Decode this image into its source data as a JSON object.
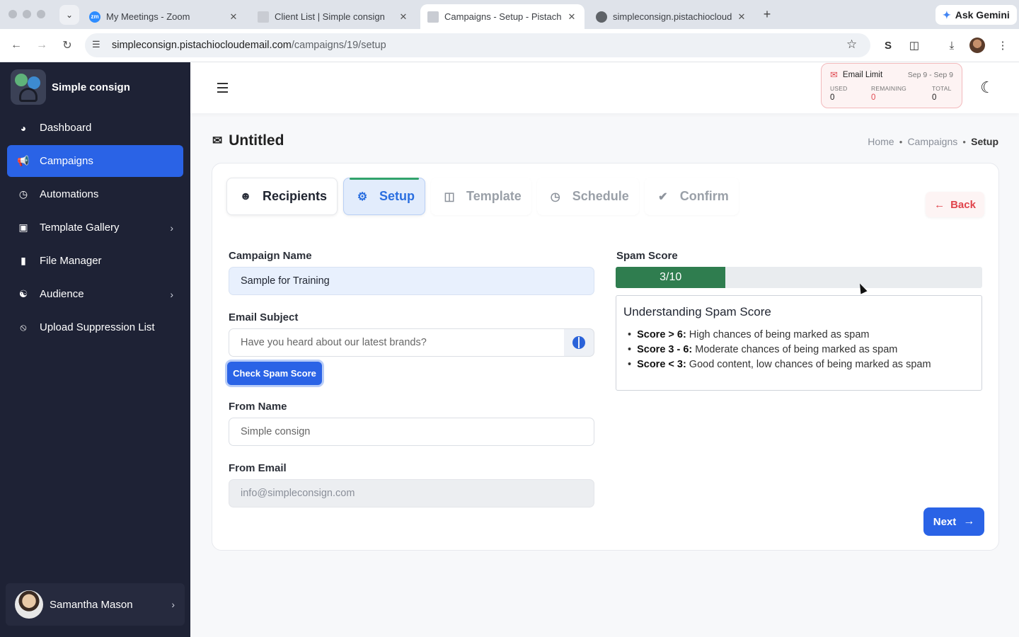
{
  "browser": {
    "tabs": [
      {
        "title": "My Meetings - Zoom",
        "favicon": "zoom-icon",
        "favicon_text": "zm",
        "favicon_color": "#2d8cff",
        "active": false
      },
      {
        "title": "Client List | Simple consign",
        "favicon": "pistachio-icon",
        "active": false
      },
      {
        "title": "Campaigns - Setup - Pistachi",
        "favicon": "pistachio-icon",
        "active": true
      },
      {
        "title": "simpleconsign.pistachiocloud",
        "favicon": "globe-icon",
        "active": false
      }
    ],
    "gemini_label": "Ask Gemini",
    "url_host": "simpleconsign.pistachiocloudemail.com",
    "url_path": "/campaigns/19/setup"
  },
  "sidebar": {
    "brand": "Simple consign",
    "items": [
      {
        "label": "Dashboard",
        "icon": "dashboard-icon",
        "active": false,
        "chevron": false
      },
      {
        "label": "Campaigns",
        "icon": "megaphone-icon",
        "active": true,
        "chevron": false
      },
      {
        "label": "Automations",
        "icon": "clock-icon",
        "active": false,
        "chevron": false
      },
      {
        "label": "Template Gallery",
        "icon": "gallery-icon",
        "active": false,
        "chevron": true
      },
      {
        "label": "File Manager",
        "icon": "file-icon",
        "active": false,
        "chevron": false
      },
      {
        "label": "Audience",
        "icon": "users-icon",
        "active": false,
        "chevron": true
      },
      {
        "label": "Upload Suppression List",
        "icon": "user-slash-icon",
        "active": false,
        "chevron": false
      }
    ],
    "user_name": "Samantha Mason"
  },
  "header": {
    "email_limit": {
      "title": "Email Limit",
      "range": "Sep 9 - Sep 9",
      "used_label": "USED",
      "used": "0",
      "remaining_label": "REMAINING",
      "remaining": "0",
      "total_label": "TOTAL",
      "total": "0"
    }
  },
  "page": {
    "title": "Untitled",
    "breadcrumb": [
      "Home",
      "Campaigns",
      "Setup"
    ]
  },
  "steps": [
    {
      "label": "Recipients",
      "icon": "users-icon",
      "state": "done"
    },
    {
      "label": "Setup",
      "icon": "gear-icon",
      "state": "active"
    },
    {
      "label": "Template",
      "icon": "layout-icon",
      "state": "todo"
    },
    {
      "label": "Schedule",
      "icon": "clock-icon",
      "state": "todo"
    },
    {
      "label": "Confirm",
      "icon": "check-circle-icon",
      "state": "todo"
    }
  ],
  "back_label": "Back",
  "form": {
    "campaign_name_label": "Campaign Name",
    "campaign_name_value": "Sample for Training",
    "email_subject_label": "Email Subject",
    "email_subject_placeholder": "Have you heard about our latest brands?",
    "check_spam_label": "Check Spam Score",
    "from_name_label": "From Name",
    "from_name_placeholder": "Simple consign",
    "from_email_label": "From Email",
    "from_email_value": "info@simpleconsign.com"
  },
  "spam": {
    "label": "Spam Score",
    "score": 3,
    "max": 10,
    "score_text": "3/10",
    "fill_color": "#2f7d4f",
    "info_title": "Understanding Spam Score",
    "rules": [
      {
        "key": "Score > 6:",
        "text": "High chances of being marked as spam"
      },
      {
        "key": "Score 3 - 6:",
        "text": "Moderate chances of being marked as spam"
      },
      {
        "key": "Score < 3:",
        "text": "Good content, low chances of being marked as spam"
      }
    ]
  },
  "next_label": "Next",
  "colors": {
    "accent": "#2a63e6",
    "sidebar_bg": "#1e2235",
    "danger": "#e0434b",
    "success": "#31a36b"
  }
}
